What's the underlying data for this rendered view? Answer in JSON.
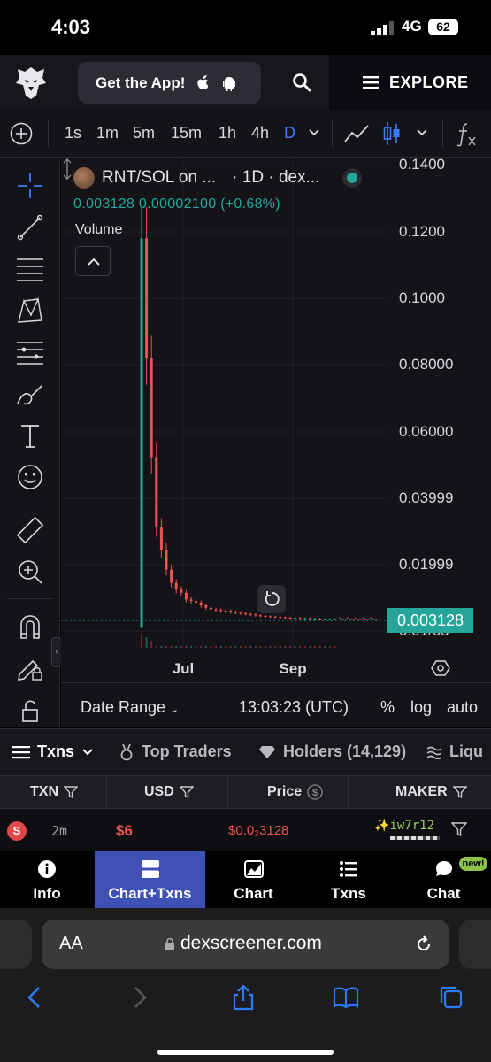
{
  "status_bar": {
    "time": "4:03",
    "network": "4G",
    "battery": "62"
  },
  "top_nav": {
    "get_app_label": "Get the App!",
    "explore_label": "EXPLORE"
  },
  "timeframes": [
    "1s",
    "1m",
    "5m",
    "15m",
    "1h",
    "4h",
    "D"
  ],
  "active_timeframe": "D",
  "chart_header": {
    "pair": "RNT/SOL on ...",
    "interval_source": "· 1D · dex...",
    "ohlc": "0.003128  0.00002100 (+0.68%)",
    "volume_label": "Volume"
  },
  "chart_footer": {
    "date_range": "Date Range",
    "clock": "13:03:23 (UTC)",
    "percent": "%",
    "log": "log",
    "auto": "auto"
  },
  "chart_data": {
    "type": "candlestick",
    "y_ticks": [
      "0.1400",
      "0.1200",
      "0.1000",
      "0.08000",
      "0.06000",
      "0.03999",
      "0.01999",
      "0.01/65"
    ],
    "x_ticks": [
      "Jul",
      "Sep"
    ],
    "last_price": "0.003128",
    "ylim": [
      0,
      0.14
    ],
    "series_close": [
      0.118,
      0.082,
      0.052,
      0.031,
      0.024,
      0.018,
      0.014,
      0.012,
      0.011,
      0.009,
      0.0085,
      0.008,
      0.0072,
      0.0065,
      0.006,
      0.0058,
      0.0056,
      0.0055,
      0.0052,
      0.005,
      0.0048,
      0.0046,
      0.0044,
      0.0042,
      0.004,
      0.0039,
      0.0038,
      0.0037,
      0.0036,
      0.0035,
      0.0034,
      0.0034,
      0.0033,
      0.0033,
      0.0032,
      0.0032,
      0.0031,
      0.0031,
      0.0031,
      0.0031
    ]
  },
  "tabs": {
    "txns": "Txns",
    "top_traders": "Top Traders",
    "holders": "Holders (14,129)",
    "liquidity": "Liqu"
  },
  "table": {
    "headers": [
      "TXN",
      "USD",
      "Price",
      "MAKER"
    ],
    "rows": [
      {
        "type": "S",
        "age": "2m",
        "usd": "$6",
        "price": "$0.0₂3128",
        "maker": "iw7r12"
      }
    ]
  },
  "app_tabs": [
    "Info",
    "Chart+Txns",
    "Chart",
    "Txns",
    "Chat"
  ],
  "chat_badge": "new!",
  "browser": {
    "aa": "AA",
    "url": "dexscreener.com"
  },
  "colors": {
    "up": "#26a69a",
    "down": "#ef5350",
    "accent": "#3e7bff",
    "active_tab": "#3f51b5"
  }
}
